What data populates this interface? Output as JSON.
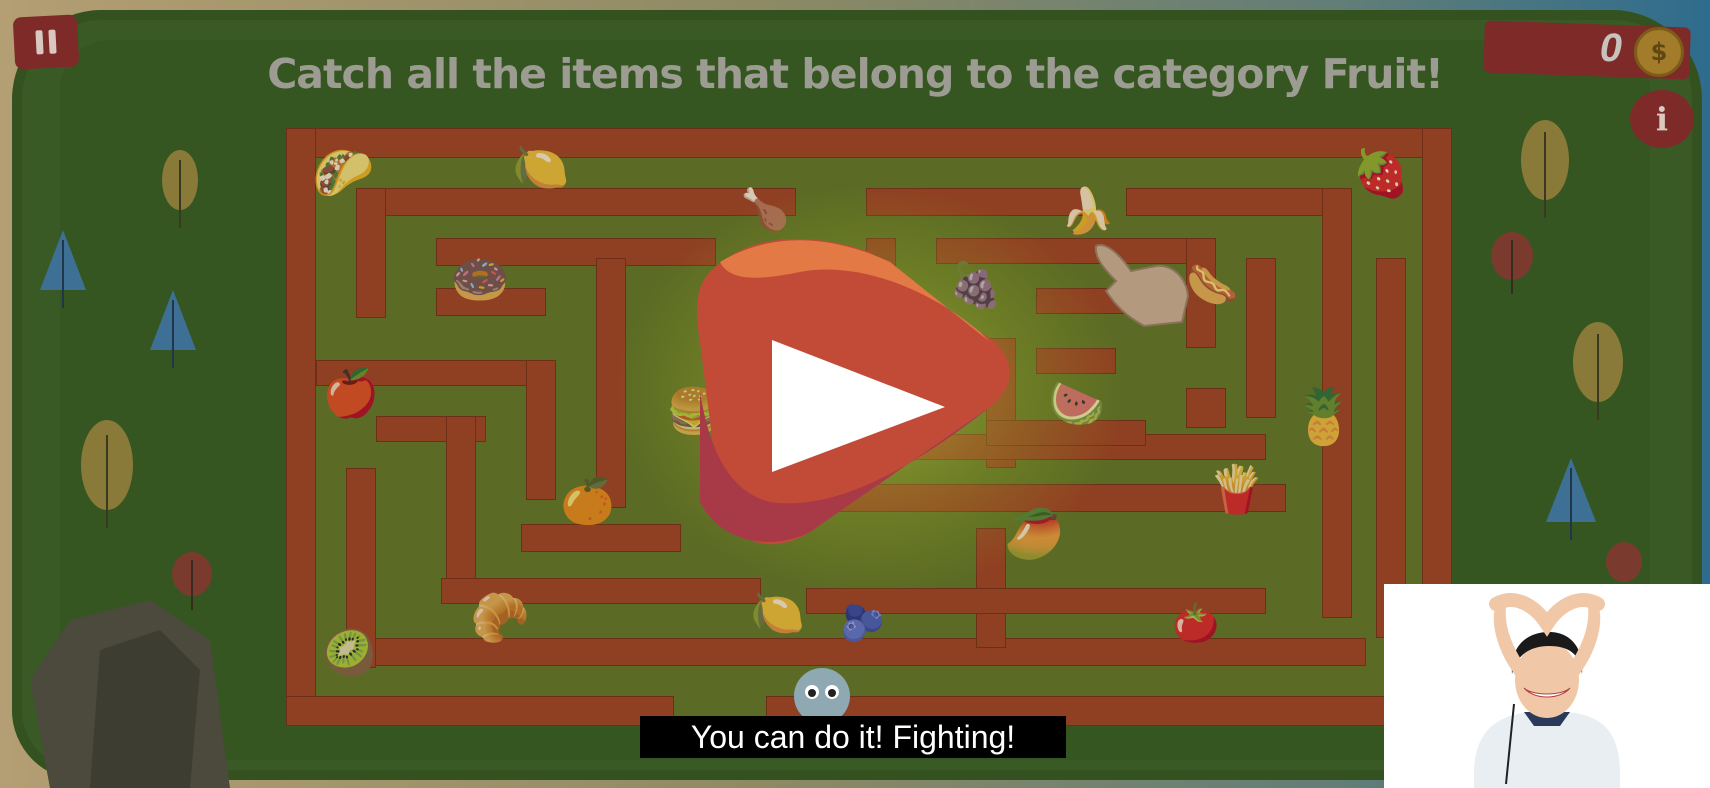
{
  "header": {
    "instruction": "Catch all the items that belong to the category Fruit!"
  },
  "hud": {
    "score": "0",
    "coin_symbol": "$",
    "info_label": "i"
  },
  "overlay": {
    "subtitle": "You can do it! Fighting!"
  },
  "colors": {
    "hedge": "#3a5a25",
    "maze_path": "#5b6a24",
    "maze_wall": "#8f3f22",
    "play_button": "#c9533f",
    "wood_plank": "#7e2a28",
    "coin": "#a27c2a"
  },
  "items": [
    {
      "name": "taco",
      "glyph": "🌮"
    },
    {
      "name": "lemon",
      "glyph": "🍋"
    },
    {
      "name": "roast-chicken",
      "glyph": "🍗"
    },
    {
      "name": "banana",
      "glyph": "🍌"
    },
    {
      "name": "strawberry",
      "glyph": "🍓"
    },
    {
      "name": "donut",
      "glyph": "🍩"
    },
    {
      "name": "raspberry",
      "glyph": "🍇"
    },
    {
      "name": "hot-dog",
      "glyph": "🌭"
    },
    {
      "name": "pomegranate",
      "glyph": "🍎"
    },
    {
      "name": "watermelon",
      "glyph": "🍉"
    },
    {
      "name": "burger",
      "glyph": "🍔"
    },
    {
      "name": "pineapple",
      "glyph": "🍍"
    },
    {
      "name": "orange",
      "glyph": "🍊"
    },
    {
      "name": "french-fries",
      "glyph": "🍟"
    },
    {
      "name": "mango",
      "glyph": "🥭"
    },
    {
      "name": "croissant",
      "glyph": "🥐"
    },
    {
      "name": "lemon-slice",
      "glyph": "🍋"
    },
    {
      "name": "grapes",
      "glyph": "🫐"
    },
    {
      "name": "tomato",
      "glyph": "🍅"
    },
    {
      "name": "kiwi",
      "glyph": "🥝"
    }
  ]
}
